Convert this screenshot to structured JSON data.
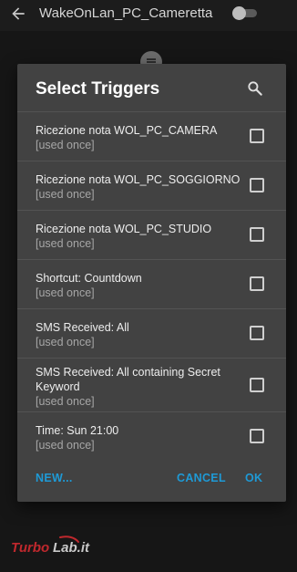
{
  "appbar": {
    "title": "WakeOnLan_PC_Cameretta"
  },
  "dialog": {
    "title": "Select Triggers",
    "items": [
      {
        "label": "Ricezione nota WOL_PC_CAMERA",
        "sub": "[used once]",
        "checked": false
      },
      {
        "label": "Ricezione nota WOL_PC_SOGGIORNO",
        "sub": "[used once]",
        "checked": false
      },
      {
        "label": "Ricezione nota WOL_PC_STUDIO",
        "sub": "[used once]",
        "checked": false
      },
      {
        "label": "Shortcut: Countdown",
        "sub": "[used once]",
        "checked": false
      },
      {
        "label": "SMS Received: All",
        "sub": "[used once]",
        "checked": false
      },
      {
        "label": "SMS Received: All containing Secret Keyword",
        "sub": "[used once]",
        "checked": false
      },
      {
        "label": "Time: Sun 21:00",
        "sub": "[used once]",
        "checked": false
      }
    ],
    "buttons": {
      "new": "NEW...",
      "cancel": "CANCEL",
      "ok": "OK"
    }
  },
  "watermark": "TurboLab.it",
  "colors": {
    "accent": "#1e9ad6",
    "dialog_bg": "#424242",
    "screen_bg": "#161616"
  }
}
